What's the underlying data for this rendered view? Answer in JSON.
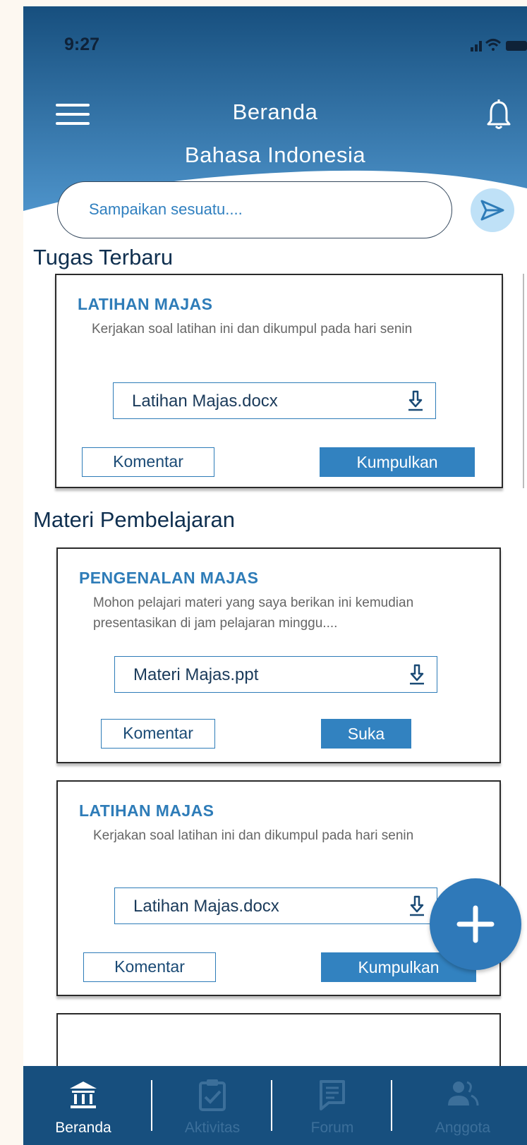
{
  "status_bar": {
    "time": "9:27"
  },
  "header": {
    "title": "Beranda",
    "subtitle": "Bahasa Indonesia"
  },
  "post_box": {
    "placeholder": "Sampaikan sesuatu...."
  },
  "sections": {
    "assignments": "Tugas Terbaru",
    "materials": "Materi Pembelajaran"
  },
  "cards": [
    {
      "title": "LATIHAN MAJAS",
      "description": "Kerjakan soal latihan ini dan dikumpul pada hari senin",
      "file": "Latihan Majas.docx",
      "comment_label": "Komentar",
      "action_label": "Kumpulkan"
    },
    {
      "title": "PENGENALAN MAJAS",
      "description": "Mohon pelajari materi yang saya berikan ini kemudian presentasikan di jam pelajaran minggu....",
      "file": "Materi Majas.ppt",
      "comment_label": "Komentar",
      "action_label": "Suka"
    },
    {
      "title": "LATIHAN MAJAS",
      "description": "Kerjakan soal latihan ini dan dikumpul pada hari senin",
      "file": "Latihan Majas.docx",
      "comment_label": "Komentar",
      "action_label": "Kumpulkan"
    }
  ],
  "fab": {
    "icon": "plus-icon"
  },
  "bottom_nav": [
    {
      "label": "Beranda",
      "icon": "bank-icon",
      "active": true
    },
    {
      "label": "Aktivitas",
      "icon": "clipboard-check-icon",
      "active": false
    },
    {
      "label": "Forum",
      "icon": "document-icon",
      "active": false
    },
    {
      "label": "Anggota",
      "icon": "users-icon",
      "active": false
    }
  ],
  "colors": {
    "header_top": "#174f7e",
    "header_bottom": "#4a8fc6",
    "accent": "#2e7cb8",
    "nav_bg": "#174f7e",
    "nav_inactive": "#3c6f9a",
    "page_bg": "#fdf8f1"
  }
}
